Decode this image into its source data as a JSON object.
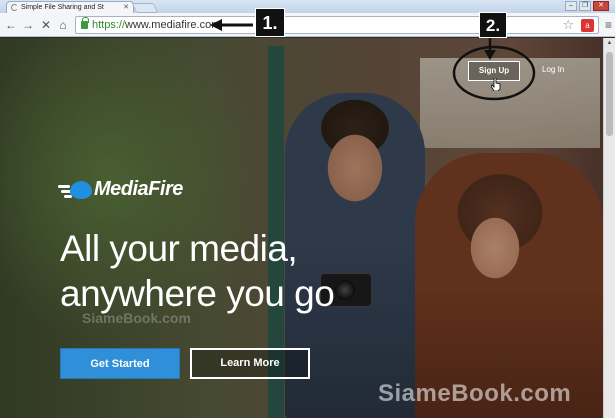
{
  "browser": {
    "tab_title": "Simple File Sharing and St",
    "url_scheme": "https://",
    "url_host": "www.mediafire.com",
    "window_controls": [
      "minimize",
      "restore",
      "close"
    ]
  },
  "site": {
    "brand": "MediaFire",
    "headline_line1": "All your media,",
    "headline_line2": "anywhere you go",
    "get_started": "Get Started",
    "learn_more": "Learn More",
    "sign_up": "Sign Up",
    "log_in": "Log In",
    "brand_color": "#2f8fd8"
  },
  "annotations": {
    "step1": "1.",
    "step2": "2."
  },
  "watermark": {
    "text": "SiameBook.com",
    "mid_text": "SiameBook.com"
  }
}
